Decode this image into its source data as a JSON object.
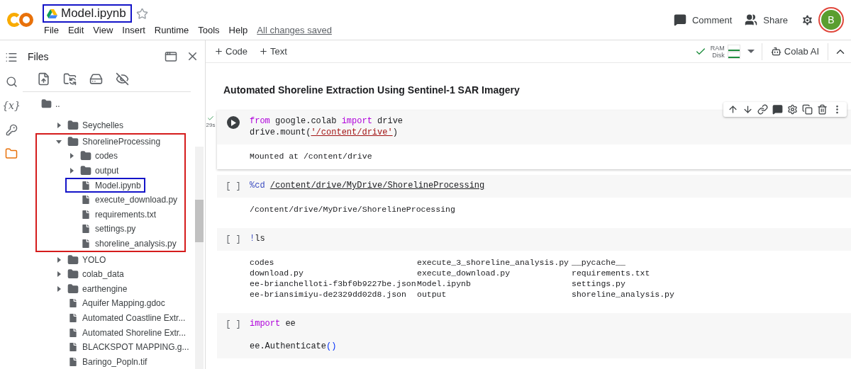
{
  "header": {
    "title": "Model.ipynb",
    "title_outlined": true,
    "starred": false,
    "menu": [
      "File",
      "Edit",
      "View",
      "Insert",
      "Runtime",
      "Tools",
      "Help"
    ],
    "save_status": "All changes saved",
    "actions": [
      {
        "kind": "comment",
        "label": "Comment"
      },
      {
        "kind": "share",
        "label": "Share"
      }
    ],
    "avatar": "B"
  },
  "rail": [
    {
      "kind": "toc",
      "selected": false
    },
    {
      "kind": "search",
      "selected": false
    },
    {
      "kind": "variables",
      "label": "{x}",
      "selected": false
    },
    {
      "kind": "secrets",
      "selected": false
    },
    {
      "kind": "files",
      "selected": true
    }
  ],
  "files_panel": {
    "title": "Files",
    "parent": "..",
    "tree": [
      {
        "kind": "folder",
        "name": "Seychelles",
        "expanded": false
      },
      {
        "kind": "folder",
        "name": "ShorelineProcessing",
        "expanded": true,
        "outlined": true,
        "children": [
          {
            "kind": "folder",
            "name": "codes",
            "expanded": false
          },
          {
            "kind": "folder",
            "name": "output",
            "expanded": false
          },
          {
            "kind": "file",
            "name": "Model.ipynb",
            "outlined": true
          },
          {
            "kind": "file",
            "name": "execute_download.py",
            "outlined": false
          },
          {
            "kind": "file",
            "name": "requirements.txt",
            "outlined": false
          },
          {
            "kind": "file",
            "name": "settings.py",
            "outlined": false
          },
          {
            "kind": "file",
            "name": "shoreline_analysis.py",
            "outlined": false
          }
        ]
      },
      {
        "kind": "folder",
        "name": "YOLO",
        "expanded": false
      },
      {
        "kind": "folder",
        "name": "colab_data",
        "expanded": false
      },
      {
        "kind": "folder",
        "name": "earthengine",
        "expanded": false
      },
      {
        "kind": "file",
        "name": "Aquifer Mapping.gdoc",
        "outlined": false
      },
      {
        "kind": "file",
        "name": "Automated Coastline Extr...",
        "outlined": false
      },
      {
        "kind": "file",
        "name": "Automated Shoreline Extr...",
        "outlined": false
      },
      {
        "kind": "file",
        "name": "BLACKSPOT MAPPING.g...",
        "outlined": false
      },
      {
        "kind": "file",
        "name": "Baringo_Popln.tif",
        "outlined": false
      }
    ]
  },
  "toolbar": {
    "add": [
      "Code",
      "Text"
    ],
    "connected": true,
    "meters": [
      {
        "label": "RAM"
      },
      {
        "label": "Disk"
      }
    ],
    "ai_label": "Colab AI"
  },
  "notebook": {
    "heading": "Automated Shoreline Extraction Using Sentinel-1 SAR Imagery",
    "cells": [
      {
        "focused": true,
        "executed": true,
        "duration": "29s",
        "lines": [
          [
            {
              "kind": "keyword",
              "text": "from"
            },
            {
              "kind": "plain",
              "text": " google.colab "
            },
            {
              "kind": "keyword",
              "text": "import"
            },
            {
              "kind": "plain",
              "text": " drive"
            }
          ],
          [
            {
              "kind": "plain",
              "text": "drive.mount("
            },
            {
              "kind": "string",
              "text": "'/content/drive'"
            },
            {
              "kind": "plain",
              "text": ")"
            }
          ]
        ],
        "output": {
          "kind": "text",
          "lines": [
            "Mounted at /content/drive"
          ]
        }
      },
      {
        "focused": false,
        "prompt": "[ ]",
        "lines": [
          [
            {
              "kind": "magic",
              "text": "%cd "
            },
            {
              "kind": "path",
              "text": "/content/drive/MyDrive/ShorelineProcessing"
            }
          ]
        ],
        "output": {
          "kind": "text",
          "lines": [
            "/content/drive/MyDrive/ShorelineProcessing"
          ]
        }
      },
      {
        "focused": false,
        "prompt": "[ ]",
        "lines": [
          [
            {
              "kind": "magic",
              "text": "!"
            },
            {
              "kind": "plain",
              "text": "ls"
            }
          ]
        ],
        "output": {
          "kind": "columns",
          "columns": [
            [
              "codes",
              "download.py",
              "ee-brianchelloti-f3bf0b9227be.json",
              "ee-briansimiyu-de2329dd02d8.json"
            ],
            [
              "execute_3_shoreline_analysis.py",
              "execute_download.py",
              "Model.ipynb",
              "output"
            ],
            [
              "__pycache__",
              "requirements.txt",
              "settings.py",
              "shoreline_analysis.py"
            ]
          ]
        }
      },
      {
        "focused": false,
        "prompt": "[ ]",
        "lines": [
          [
            {
              "kind": "keyword",
              "text": "import"
            },
            {
              "kind": "plain",
              "text": " ee"
            }
          ]
        ],
        "more_lines": [
          [
            {
              "kind": "plain",
              "text": "ee.Authenticate"
            },
            {
              "kind": "paren",
              "text": "()"
            }
          ]
        ]
      }
    ]
  }
}
